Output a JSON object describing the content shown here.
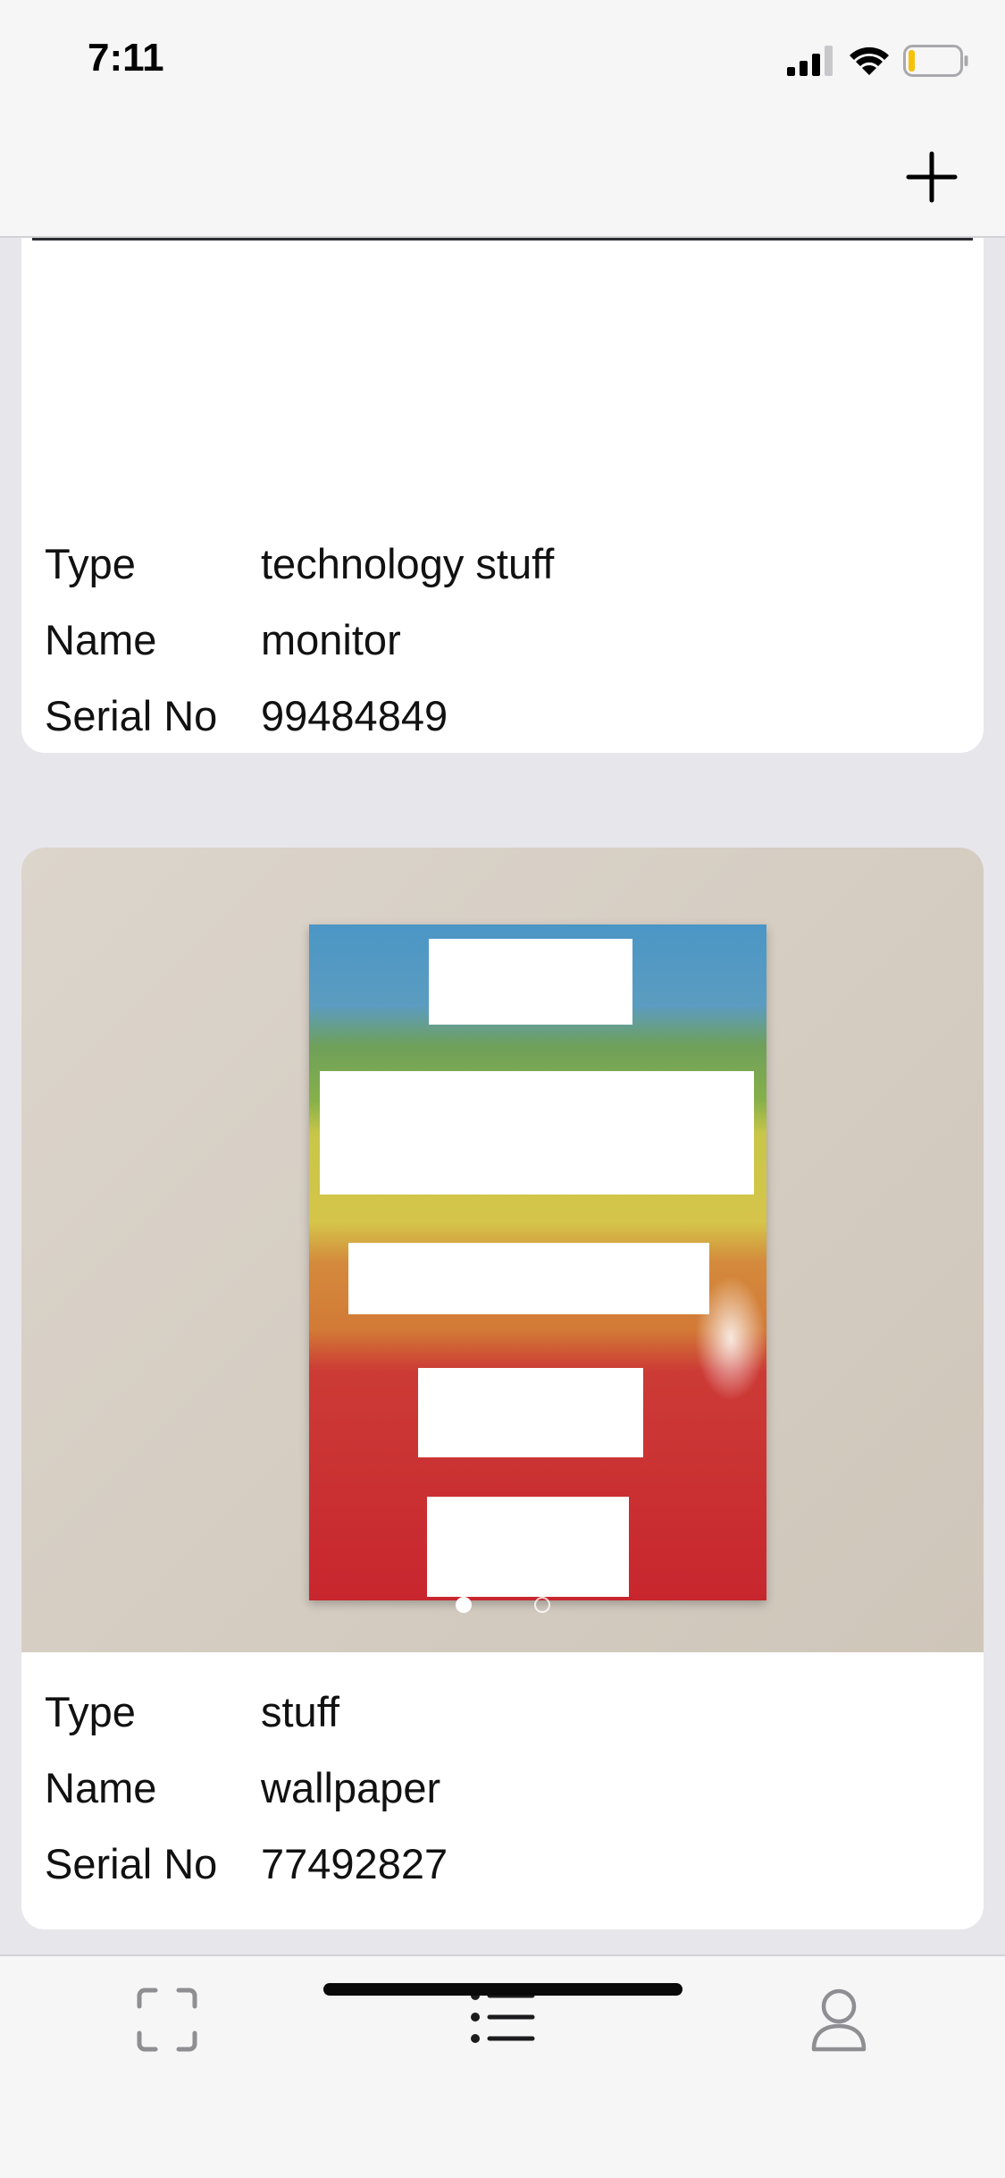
{
  "status_bar": {
    "time": "7:11",
    "icons": [
      "signal-icon",
      "wifi-icon",
      "battery-icon"
    ],
    "battery_color": "#f5c20a"
  },
  "nav_bar": {
    "add_icon": "plus-icon"
  },
  "items": [
    {
      "fields": [
        {
          "label": "Type",
          "value": "technology stuff"
        },
        {
          "label": "Name",
          "value": "monitor"
        },
        {
          "label": "Serial No",
          "value": "99484849"
        }
      ]
    },
    {
      "image": "rainbow-poster-photo",
      "image_pages": 2,
      "current_page": 1,
      "fields": [
        {
          "label": "Type",
          "value": "stuff"
        },
        {
          "label": "Name",
          "value": "wallpaper"
        },
        {
          "label": "Serial No",
          "value": "77492827"
        }
      ]
    }
  ],
  "tab_bar": {
    "tabs": [
      {
        "icon": "scan-frame-icon",
        "active": false
      },
      {
        "icon": "list-icon",
        "active": true
      },
      {
        "icon": "profile-icon",
        "active": false
      }
    ],
    "active_color": "#1c1c1e",
    "inactive_color": "#8e8e93"
  }
}
